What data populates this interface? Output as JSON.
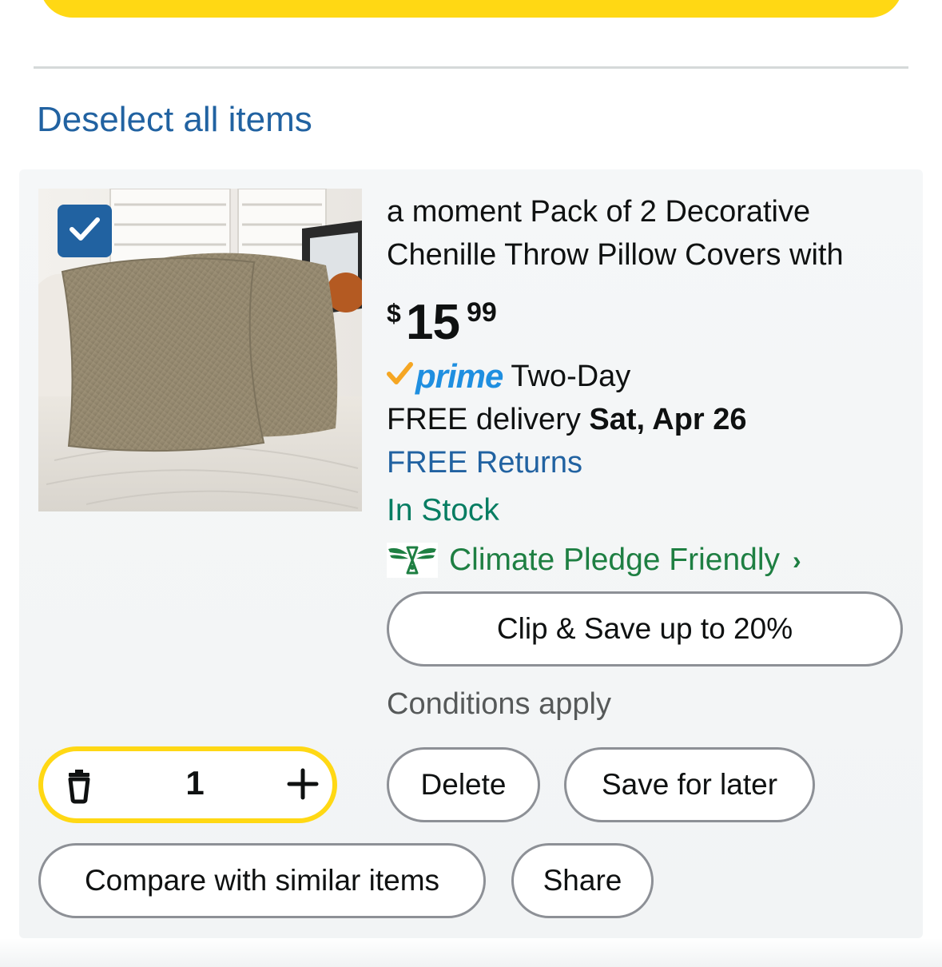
{
  "header": {
    "deselect_label": "Deselect all items"
  },
  "item": {
    "title": "a moment Pack of 2 Decorative Chenille Throw Pillow Covers with",
    "price": {
      "currency": "$",
      "whole": "15",
      "fraction": "99"
    },
    "prime": {
      "word": "prime",
      "speed": "Two-Day"
    },
    "delivery": {
      "prefix": "FREE delivery",
      "date": "Sat, Apr 26"
    },
    "returns": "FREE Returns",
    "stock": "In Stock",
    "climate": {
      "label": "Climate Pledge Friendly",
      "chevron": "›"
    },
    "coupon": {
      "label": "Clip & Save up to 20%",
      "note": "Conditions apply"
    },
    "quantity": "1",
    "selected": true
  },
  "actions": {
    "delete": "Delete",
    "save_for_later": "Save for later",
    "compare": "Compare with similar items",
    "share": "Share"
  },
  "icons": {
    "checkbox": "checkmark-icon",
    "trash": "trash-icon",
    "plus": "plus-icon",
    "prime_check": "prime-check-icon",
    "climate": "climate-pledge-icon"
  },
  "colors": {
    "accent_yellow": "#ffd814",
    "link_blue": "#2162a1",
    "stock_green": "#067d62",
    "climate_green": "#1e7f42",
    "prime_blue": "#1f8fe0",
    "prime_orange": "#f5a623"
  }
}
